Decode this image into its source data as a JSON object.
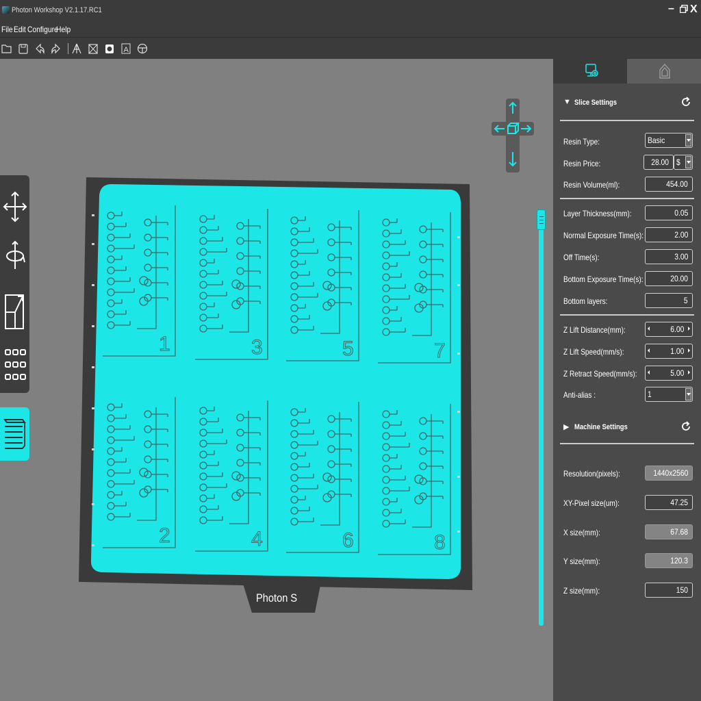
{
  "window": {
    "title": "Photon Workshop V2.1.17.RC1",
    "minimize_label": "–",
    "maximize_label": "ő",
    "close_label": "X"
  },
  "menu": {
    "items": [
      "File",
      "Edit",
      "Configure",
      "Help"
    ]
  },
  "toolbar": {
    "icons": [
      "open-file-icon",
      "save-icon",
      "undo-icon",
      "redo-icon",
      "support-icon",
      "hollow-icon",
      "slice-icon",
      "text-icon",
      "print-icon"
    ]
  },
  "left_tools": [
    "move-icon",
    "rotate-icon",
    "scale-icon",
    "array-icon"
  ],
  "viewport": {
    "plate_label": "Photon S",
    "model_numbers": [
      "1",
      "3",
      "5",
      "7",
      "2",
      "4",
      "6",
      "8"
    ],
    "accent_color": "#1de6e6"
  },
  "tabs": {
    "slice_icon": "monitor-gear-icon",
    "machine_icon": "printer-icon"
  },
  "slice_settings": {
    "header": "Slice Settings",
    "resin_type_label": "Resin Type:",
    "resin_type_value": "Basic",
    "resin_price_label": "Resin Price:",
    "resin_price_value": "28.00",
    "currency": "$",
    "resin_volume_label": "Resin Volume(ml):",
    "resin_volume_value": "454.00",
    "layer_thickness_label": "Layer Thickness(mm):",
    "layer_thickness_value": "0.05",
    "normal_exposure_label": "Normal Exposure Time(s):",
    "normal_exposure_value": "2.00",
    "off_time_label": "Off Time(s):",
    "off_time_value": "3.00",
    "bottom_exposure_label": "Bottom Exposure Time(s):",
    "bottom_exposure_value": "20.00",
    "bottom_layers_label": "Bottom layers:",
    "bottom_layers_value": "5",
    "z_lift_distance_label": "Z Lift Distance(mm):",
    "z_lift_distance_value": "6.00",
    "z_lift_speed_label": "Z Lift Speed(mm/s):",
    "z_lift_speed_value": "1.00",
    "z_retract_speed_label": "Z Retract Speed(mm/s):",
    "z_retract_speed_value": "5.00",
    "anti_alias_label": "Anti-alias :",
    "anti_alias_value": "1"
  },
  "machine_settings": {
    "header": "Machine Settings",
    "resolution_label": "Resolution(pixels):",
    "resolution_value": "1440x2560",
    "xy_pixel_label": "XY-Pixel size(um):",
    "xy_pixel_value": "47.25",
    "x_size_label": "X size(mm):",
    "x_size_value": "67.68",
    "y_size_label": "Y size(mm):",
    "y_size_value": "120.3",
    "z_size_label": "Z size(mm):",
    "z_size_value": "150"
  }
}
